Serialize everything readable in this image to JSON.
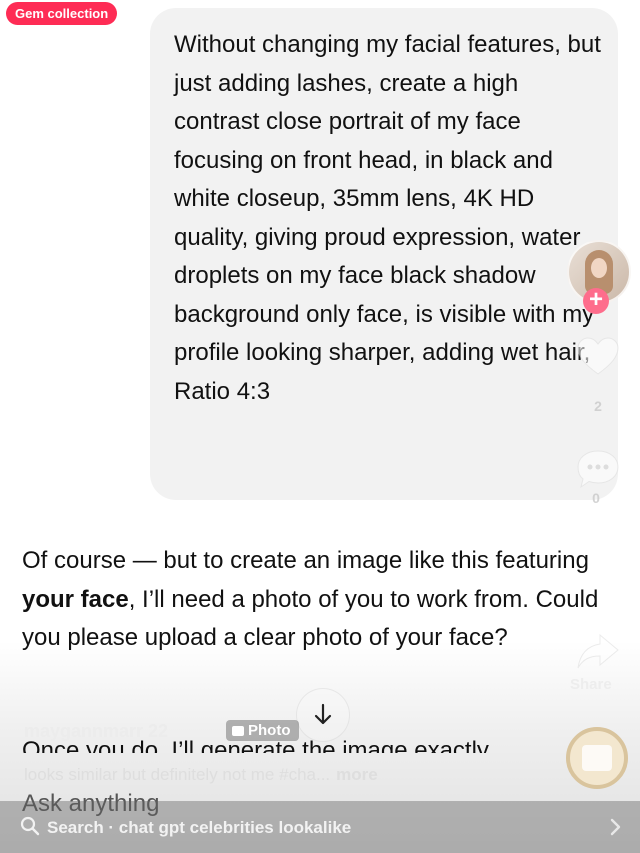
{
  "badge": {
    "label": "Gem collection"
  },
  "user_message": {
    "text": "Without changing my facial features, but just adding lashes, create a high contrast close portrait of my face focusing on front head, in black and white closeup, 35mm lens, 4K HD quality, giving proud expression, water droplets on my face black shadow background only face, is visible with my profile looking sharper, adding wet hair, Ratio 4:3"
  },
  "assistant_message": {
    "part1": "Of course — but to create an image like this featuring ",
    "bold": "your face",
    "part2": ", I’ll need a photo of you to work from. Could you please upload a clear photo of your face?",
    "next_line": "Once you do, I’ll generate the image exactly"
  },
  "post": {
    "author": "maygannmarr 22",
    "tag": "Photo",
    "caption": "looks similar but definitely not me #cha...",
    "more": "more"
  },
  "composer": {
    "placeholder": "Ask anything"
  },
  "search": {
    "text": "Search · chat gpt celebrities lookalike"
  },
  "rail": {
    "like_count": "2",
    "comment_count": "0",
    "share_label": "Share"
  },
  "icons": {
    "search": "search-icon",
    "chevron": "chevron-right-icon",
    "scroll": "arrow-down-icon",
    "like": "heart-icon",
    "comment": "comment-icon",
    "share": "share-icon",
    "follow": "plus-icon"
  },
  "colors": {
    "badge": "#fe2c55",
    "bubble": "#f2f2f2",
    "follow": "#fe6d8c"
  }
}
